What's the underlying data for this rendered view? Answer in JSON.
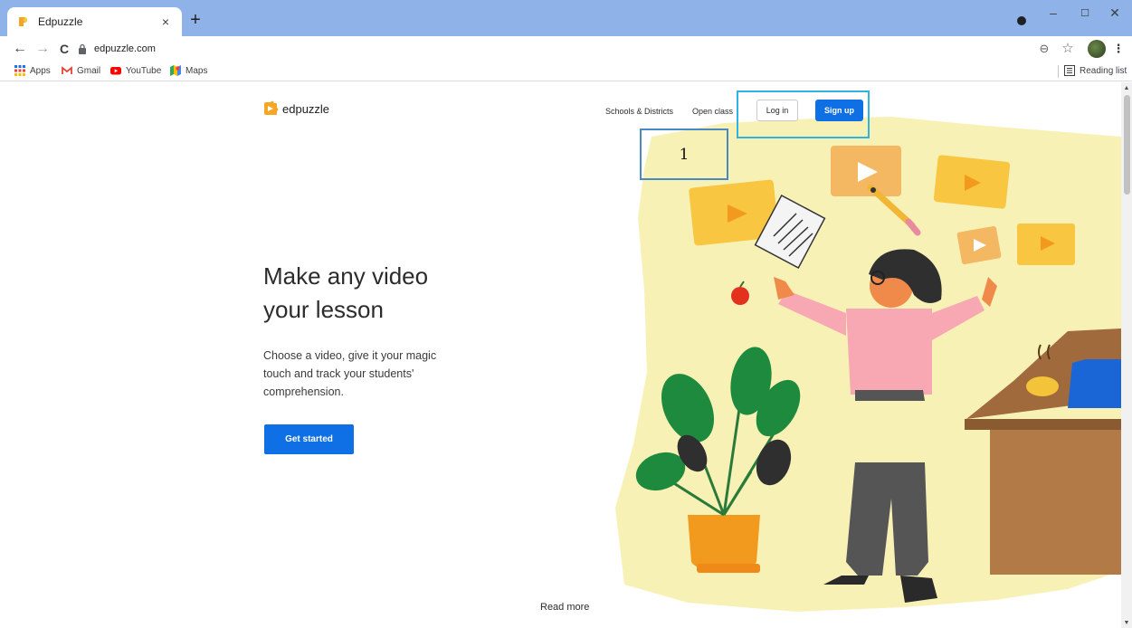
{
  "browser": {
    "tab_title": "Edpuzzle",
    "tab_close": "×",
    "new_tab": "+",
    "url": "edpuzzle.com",
    "window_controls": {
      "minimize": "–",
      "maximize": "☐",
      "close": "✕"
    },
    "nav": {
      "back": "←",
      "forward": "→",
      "reload": "C"
    },
    "toolbar_icons": {
      "zoom": "⊖",
      "star": "☆",
      "menu": "⋮"
    },
    "bookmarks": [
      {
        "label": "Apps",
        "icon": "apps-grid-icon"
      },
      {
        "label": "Gmail",
        "icon": "gmail-icon"
      },
      {
        "label": "YouTube",
        "icon": "youtube-icon"
      },
      {
        "label": "Maps",
        "icon": "maps-icon"
      }
    ],
    "reading_list": "Reading list"
  },
  "header": {
    "logo_text": "edpuzzle",
    "links": [
      "Schools & Districts",
      "Open class"
    ],
    "login_label": "Log in",
    "signup_label": "Sign up"
  },
  "annotation": {
    "label": "1"
  },
  "hero": {
    "title_line1": "Make any video",
    "title_line2": "your lesson",
    "description": "Choose a video, give it your magic touch and track your students' comprehension.",
    "cta_label": "Get started"
  },
  "footer": {
    "read_more": "Read more"
  },
  "colors": {
    "chrome_titlebar": "#8fb2e8",
    "primary_button": "#0f6fe4",
    "annotation_border": "#2eb3e3",
    "illustration_yellow": "#f8f1b6"
  }
}
